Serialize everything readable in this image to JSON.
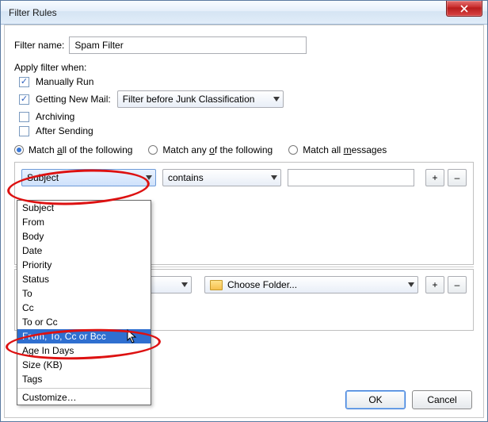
{
  "window": {
    "title": "Filter Rules"
  },
  "filter_name": {
    "label": "Filter name:",
    "value": "Spam Filter"
  },
  "apply": {
    "heading": "Apply filter when:",
    "manually": {
      "label": "Manually Run",
      "checked": true
    },
    "getting_mail": {
      "label": "Getting New Mail:",
      "checked": true,
      "combo": "Filter before Junk Classification"
    },
    "archiving": {
      "label": "Archiving",
      "checked": false
    },
    "after_sending": {
      "label": "After Sending",
      "checked": false
    }
  },
  "match": {
    "all": "Match all of the following",
    "any": "Match any of the following",
    "messages": "Match all messages",
    "selected": "all",
    "underline_hints": {
      "all": "a",
      "any": "o",
      "messages": "m"
    }
  },
  "rule": {
    "field": "Subject",
    "operator": "contains",
    "value": "",
    "plus": "+",
    "minus": "–"
  },
  "action": {
    "op": "",
    "folder_placeholder": "Choose Folder...",
    "plus": "+",
    "minus": "–"
  },
  "dropdown": {
    "items": [
      "Subject",
      "From",
      "Body",
      "Date",
      "Priority",
      "Status",
      "To",
      "Cc",
      "To or Cc",
      "From, To, Cc or Bcc",
      "Age In Days",
      "Size (KB)",
      "Tags"
    ],
    "highlighted_index": 9,
    "customize": "Customize…"
  },
  "buttons": {
    "ok": "OK",
    "cancel": "Cancel"
  }
}
